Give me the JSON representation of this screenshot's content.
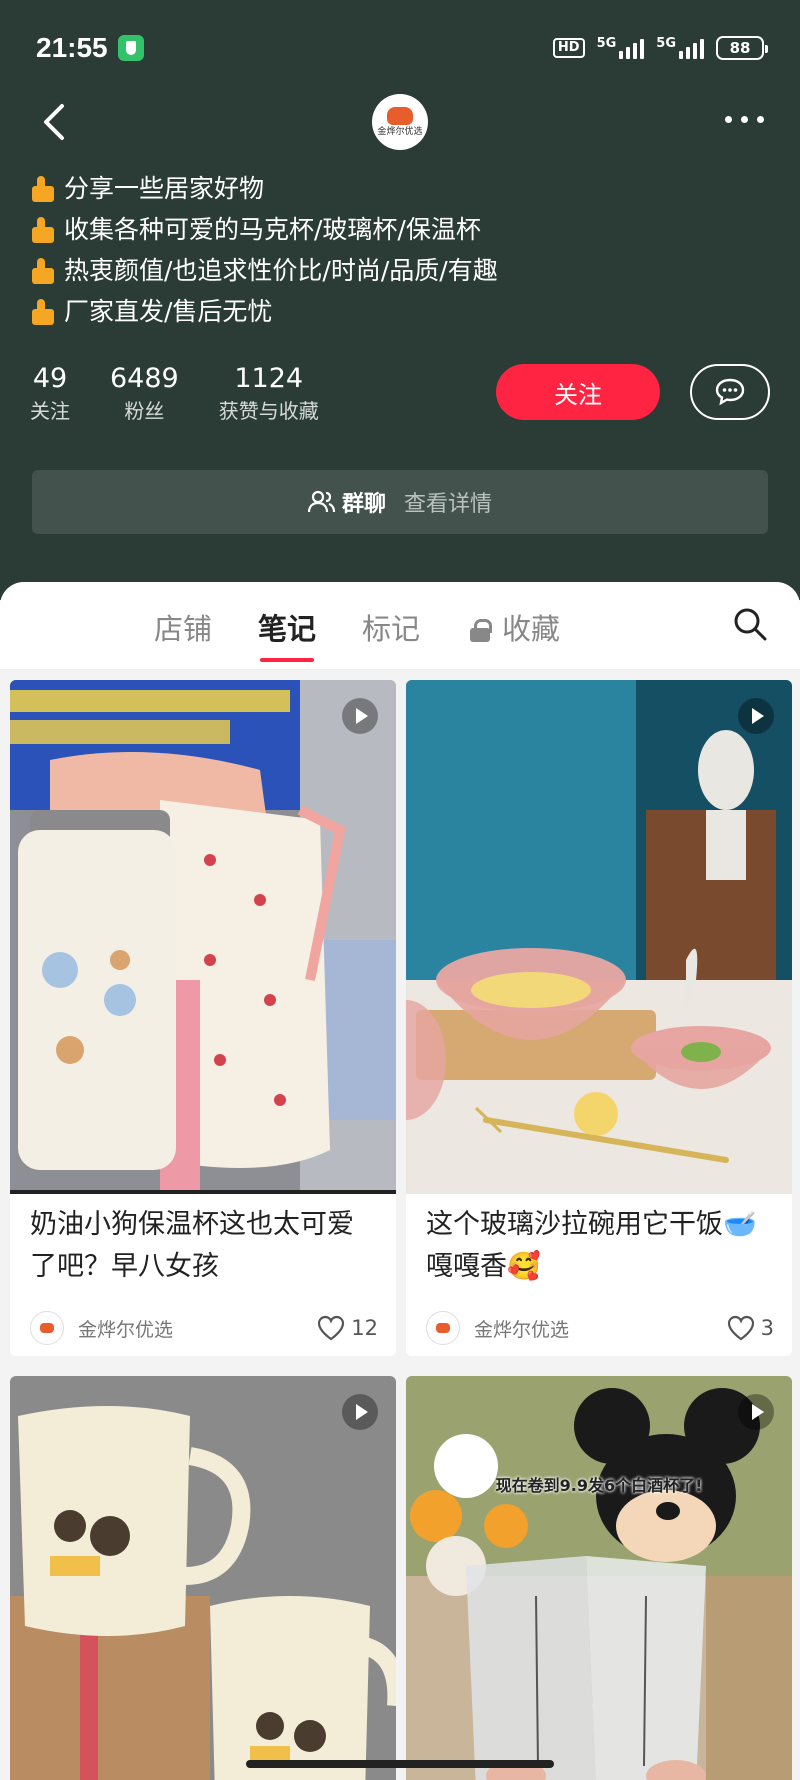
{
  "status_bar": {
    "time": "21:55",
    "hd": "HD",
    "network1": "5G",
    "network2": "5G",
    "battery": "88"
  },
  "profile": {
    "logo_text": "金烨尔优选",
    "bio": [
      "分享一些居家好物",
      "收集各种可爱的马克杯/玻璃杯/保温杯",
      "热衷颜值/也追求性价比/时尚/品质/有趣",
      "厂家直发/售后无忧"
    ],
    "stats": [
      {
        "num": "49",
        "label": "关注"
      },
      {
        "num": "6489",
        "label": "粉丝"
      },
      {
        "num": "1124",
        "label": "获赞与收藏"
      }
    ],
    "follow_label": "关注",
    "group_label": "群聊",
    "group_detail": "查看详情"
  },
  "tabs": [
    {
      "label": "店铺"
    },
    {
      "label": "笔记"
    },
    {
      "label": "标记"
    },
    {
      "label": "收藏"
    }
  ],
  "notes": [
    {
      "title": "奶油小狗保温杯这也太可爱了吧？早八女孩",
      "author": "金烨尔优选",
      "likes": "12",
      "image_text": ""
    },
    {
      "title": "这个玻璃沙拉碗用它干饭🥣嘎嘎香🥰",
      "author": "金烨尔优选",
      "likes": "3",
      "image_text": ""
    },
    {
      "title": "",
      "author": "",
      "likes": "",
      "image_text": ""
    },
    {
      "title": "",
      "author": "",
      "likes": "",
      "image_text": "现在卷到9.9发6个白酒杯了!"
    }
  ]
}
